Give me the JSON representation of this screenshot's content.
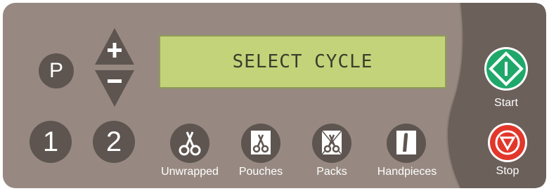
{
  "colors": {
    "panel": "#978981",
    "panel_dark": "#6b605a",
    "button": "#5e5550",
    "lcd": "#c3d37a",
    "start": "#1fa86a",
    "stop": "#e2372b"
  },
  "keys": {
    "program": "P",
    "cycle1": "1",
    "cycle2": "2",
    "up_icon": "plus-up-arrow-icon",
    "down_icon": "minus-down-arrow-icon"
  },
  "display": {
    "text": "SELECT CYCLE"
  },
  "cycles": [
    {
      "label": "Unwrapped",
      "icon": "scissors-icon"
    },
    {
      "label": "Pouches",
      "icon": "pouch-scissors-icon"
    },
    {
      "label": "Packs",
      "icon": "pack-scissors-icon"
    },
    {
      "label": "Handpieces",
      "icon": "handpiece-icon"
    }
  ],
  "actions": {
    "start_label": "Start",
    "stop_label": "Stop"
  }
}
